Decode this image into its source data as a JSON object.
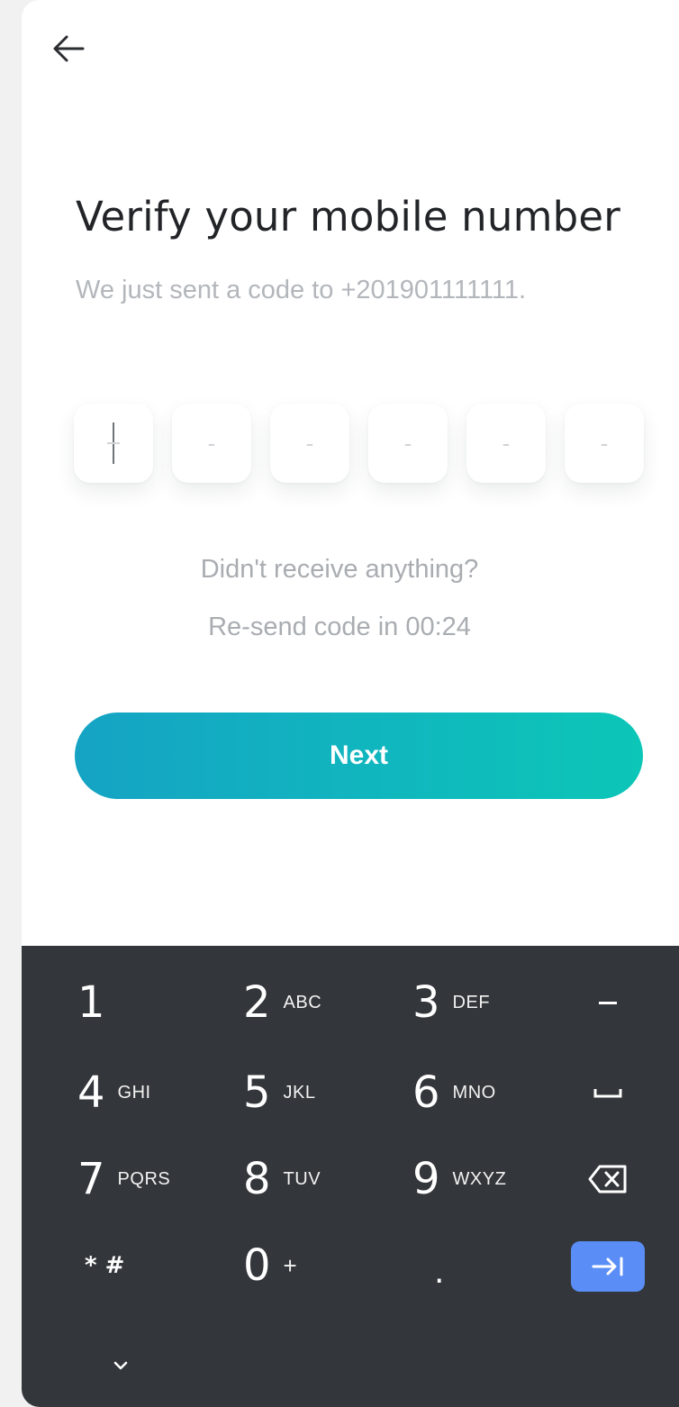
{
  "header": {
    "back_icon": "arrow-left-icon"
  },
  "main": {
    "title": "Verify your mobile number",
    "subtitle": "We just sent a code to +201901111111.",
    "otp": {
      "slots": [
        "",
        "-",
        "-",
        "-",
        "-",
        "-"
      ],
      "active_slot": 0
    },
    "resend_question": "Didn't receive anything?",
    "resend_timer_text": "Re-send code in 00:24",
    "next_label": "Next"
  },
  "keyboard": {
    "rows": [
      [
        {
          "num": "1",
          "letters": ""
        },
        {
          "num": "2",
          "letters": "ABC"
        },
        {
          "num": "3",
          "letters": "DEF"
        },
        {
          "fn": "minus",
          "label": "–"
        }
      ],
      [
        {
          "num": "4",
          "letters": "GHI"
        },
        {
          "num": "5",
          "letters": "JKL"
        },
        {
          "num": "6",
          "letters": "MNO"
        },
        {
          "fn": "space",
          "label": "space-icon"
        }
      ],
      [
        {
          "num": "7",
          "letters": "PQRS"
        },
        {
          "num": "8",
          "letters": "TUV"
        },
        {
          "num": "9",
          "letters": "WXYZ"
        },
        {
          "fn": "backspace",
          "label": "backspace-icon"
        }
      ],
      [
        {
          "num": "* #",
          "letters": ""
        },
        {
          "num": "0",
          "letters": "+"
        },
        {
          "num": ".",
          "letters": ""
        },
        {
          "fn": "enter",
          "label": "tab-enter-icon"
        }
      ]
    ],
    "collapse_icon": "chevron-down-icon"
  },
  "colors": {
    "title": "#222428",
    "muted_text": "#a9acb1",
    "button_gradient_start": "#15a3c4",
    "button_gradient_end": "#0cc6b7",
    "keyboard_bg": "#33363a",
    "enter_key": "#5a8ef6"
  }
}
